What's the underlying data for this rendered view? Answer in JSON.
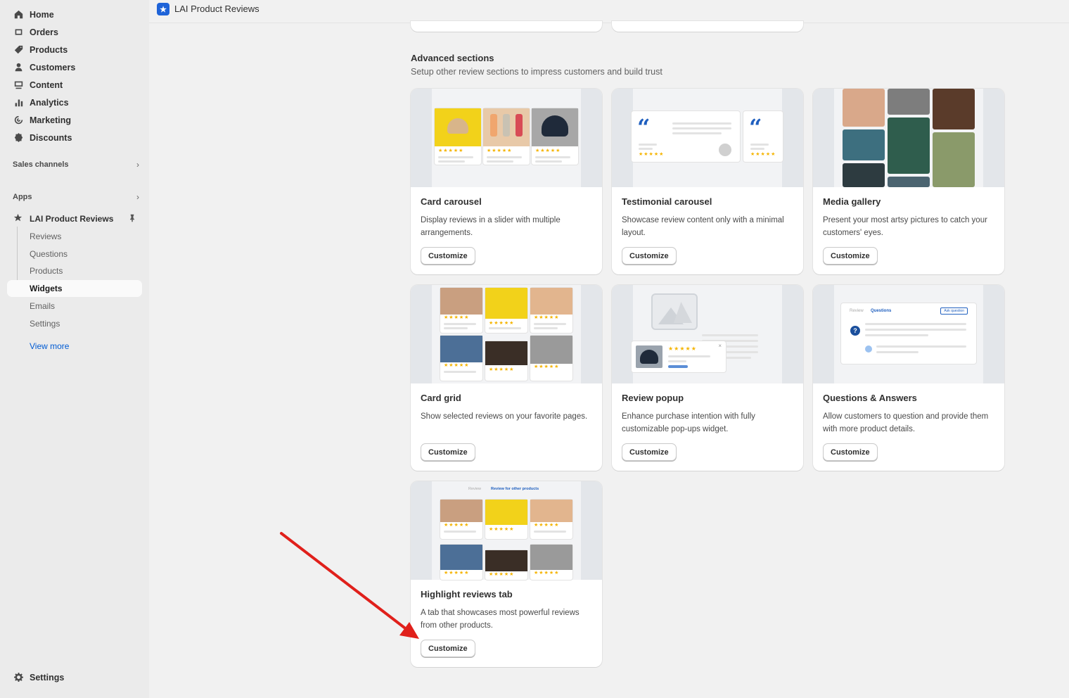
{
  "nav": {
    "items": [
      {
        "label": "Home",
        "icon": "home-icon"
      },
      {
        "label": "Orders",
        "icon": "orders-icon"
      },
      {
        "label": "Products",
        "icon": "tag-icon"
      },
      {
        "label": "Customers",
        "icon": "person-icon"
      },
      {
        "label": "Content",
        "icon": "content-icon"
      },
      {
        "label": "Analytics",
        "icon": "bar-chart-icon"
      },
      {
        "label": "Marketing",
        "icon": "target-icon"
      },
      {
        "label": "Discounts",
        "icon": "discount-icon"
      }
    ],
    "sales_channels": "Sales channels",
    "apps": "Apps",
    "app_name": "LAI Product Reviews",
    "app_subitems": [
      "Reviews",
      "Questions",
      "Products",
      "Widgets",
      "Emails",
      "Settings"
    ],
    "active_subitem": "Widgets",
    "view_more": "View more",
    "settings": "Settings"
  },
  "topbar": {
    "title": "LAI Product Reviews"
  },
  "section": {
    "title": "Advanced sections",
    "subtitle": "Setup other review sections to impress customers and build trust"
  },
  "cards": [
    {
      "title": "Card carousel",
      "description": "Display reviews in a slider with multiple arrangements.",
      "button": "Customize"
    },
    {
      "title": "Testimonial carousel",
      "description": "Showcase review content only with a minimal layout.",
      "button": "Customize"
    },
    {
      "title": "Media gallery",
      "description": "Present your most artsy pictures to catch your customers' eyes.",
      "button": "Customize"
    },
    {
      "title": "Card grid",
      "description": "Show selected reviews on your favorite pages.",
      "button": "Customize"
    },
    {
      "title": "Review popup",
      "description": "Enhance purchase intention with fully customizable pop-ups widget.",
      "button": "Customize"
    },
    {
      "title": "Questions & Answers",
      "description": "Allow customers to question and provide them with more product details.",
      "button": "Customize"
    },
    {
      "title": "Highlight reviews tab",
      "description": "A tab that showcases most powerful reviews from other products.",
      "button": "Customize"
    }
  ],
  "previews": {
    "qa_tabs": [
      "Review",
      "Questions"
    ],
    "qa_button": "Ask question",
    "highlight_tabs": [
      "Review",
      "Review for other products"
    ]
  },
  "colors": {
    "accent": "#005bd3",
    "star": "#f5b400",
    "arrow": "#e0201b"
  }
}
